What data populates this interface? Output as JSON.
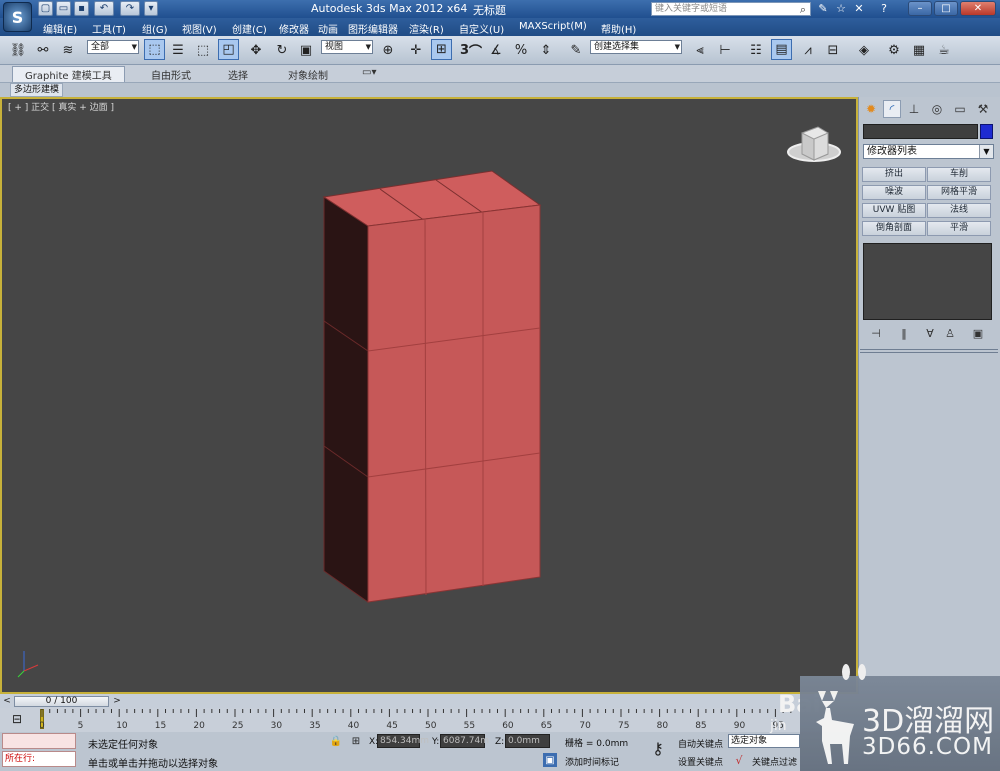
{
  "titlebar": {
    "app_title": "Autodesk 3ds Max  2012 x64",
    "file_title": "无标题",
    "search_placeholder": "键入关键字或短语",
    "logo_label": "S"
  },
  "menu": {
    "items": [
      "编辑(E)",
      "工具(T)",
      "组(G)",
      "视图(V)",
      "创建(C)",
      "修改器",
      "动画",
      "图形编辑器",
      "渲染(R)",
      "自定义(U)",
      "MAXScript(M)",
      "帮助(H)"
    ]
  },
  "toolbar": {
    "selection_filter": "全部",
    "reference_coord": "视图",
    "snap_angle_label": "3",
    "named_selection": "创建选择集"
  },
  "ribbon": {
    "tabs": [
      "Graphite 建模工具",
      "自由形式",
      "选择",
      "对象绘制"
    ],
    "sub_label": "多边形建模"
  },
  "viewport": {
    "label": "[ + ] 正交 [ 真实 + 边面 ]",
    "object_color": "#c85a5a",
    "border_color": "#c7b13a"
  },
  "command_panel": {
    "modifier_list": "修改器列表",
    "object_color": "#1e2bd2",
    "buttons": [
      "挤出",
      "车削",
      "噪波",
      "网格平滑",
      "UVW 贴图",
      "法线",
      "倒角剖面",
      "平滑"
    ]
  },
  "timeline": {
    "frame_display": "0 / 100",
    "ticks": [
      "0",
      "5",
      "10",
      "15",
      "20",
      "25",
      "30",
      "35",
      "40",
      "45",
      "50",
      "55",
      "60",
      "65",
      "70",
      "75",
      "80",
      "85",
      "90",
      "95"
    ]
  },
  "status": {
    "maxscript_label": "所在行:",
    "selection_status": "未选定任何对象",
    "prompt": "单击或单击并拖动以选择对象",
    "x_label": "X:",
    "x_value": "854.34mm",
    "y_label": "Y:",
    "y_value": "6087.74m",
    "z_label": "Z:",
    "z_value": "0.0mm",
    "grid": "栅格 = 0.0mm",
    "add_time_tag": "添加时间标记",
    "auto_key": "自动关键点",
    "set_key": "设置关键点",
    "selected_object": "选定对象",
    "key_filters": "关键点过滤"
  },
  "watermark": {
    "brand": "3D溜溜网",
    "url": "3D66.COM",
    "baidu": "Bai",
    "jingyan": "jin"
  }
}
